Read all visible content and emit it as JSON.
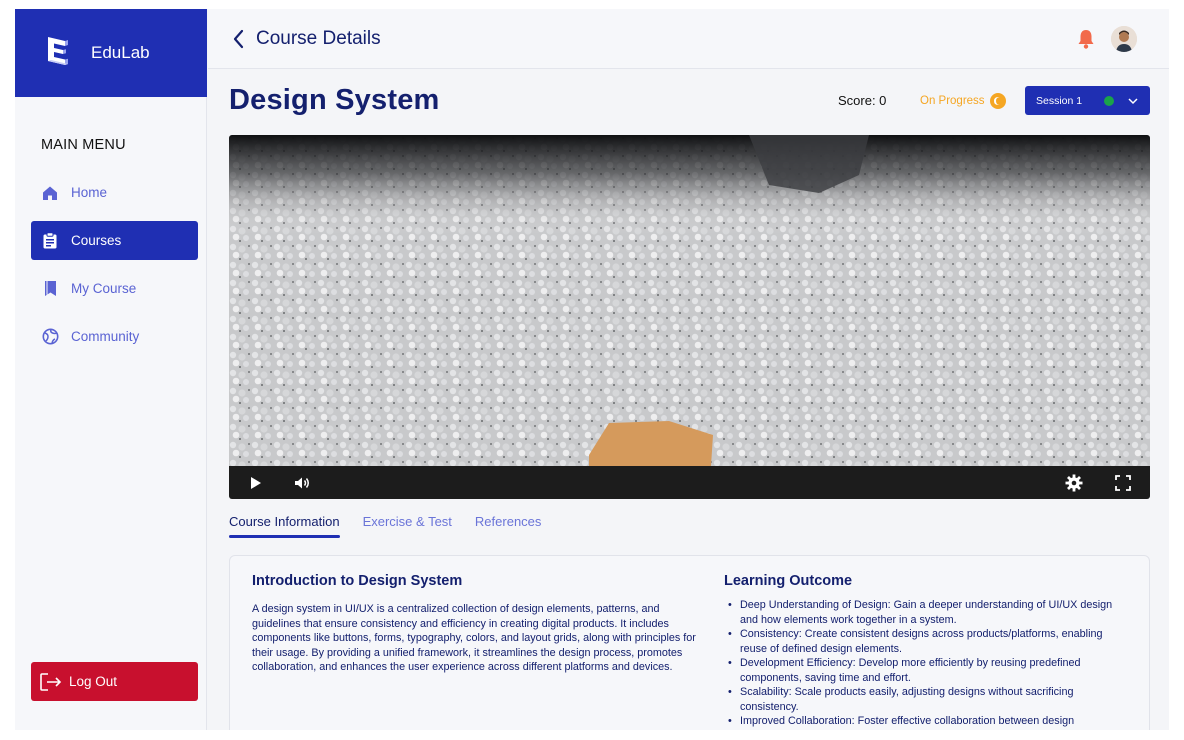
{
  "brand": {
    "name": "EduLab"
  },
  "sidebar": {
    "menu_title": "MAIN MENU",
    "items": [
      {
        "label": "Home",
        "icon": "home-icon"
      },
      {
        "label": "Courses",
        "icon": "clipboard-icon",
        "active": true
      },
      {
        "label": "My Course",
        "icon": "bookmark-icon"
      },
      {
        "label": "Community",
        "icon": "globe-icon"
      }
    ],
    "logout_label": "Log Out"
  },
  "header": {
    "title": "Course Details"
  },
  "course": {
    "title": "Design System",
    "score": "Score: 0",
    "status": "On Progress",
    "session": "Session 1"
  },
  "tabs": [
    {
      "label": "Course Information",
      "active": true
    },
    {
      "label": "Exercise & Test"
    },
    {
      "label": "References"
    }
  ],
  "info": {
    "intro_title": "Introduction to Design System",
    "intro_text": "A design system in UI/UX is a centralized collection of design elements, patterns, and guidelines that ensure consistency and efficiency in creating digital products. It includes components like buttons, forms, typography, colors, and layout grids, along with principles for their usage. By providing a unified framework, it streamlines the design process, promotes collaboration, and enhances the user experience across different platforms and devices.",
    "outcome_title": "Learning Outcome",
    "outcomes": [
      "Deep Understanding of Design: Gain a deeper understanding of UI/UX design and how elements work together in a system.",
      "Consistency: Create consistent designs across products/platforms, enabling reuse of defined design elements.",
      "Development Efficiency: Develop more efficiently by reusing predefined components, saving time and effort.",
      "Scalability: Scale products easily, adjusting designs without sacrificing consistency.",
      "Improved Collaboration: Foster effective collaboration between design"
    ]
  },
  "colors": {
    "primary": "#1f2fb3",
    "title_text": "#14206e",
    "menu_text": "#5a63d3",
    "logout": "#c8102e",
    "status": "#f5a623",
    "session_dot": "#1aa34a",
    "bell": "#f26a4b"
  }
}
